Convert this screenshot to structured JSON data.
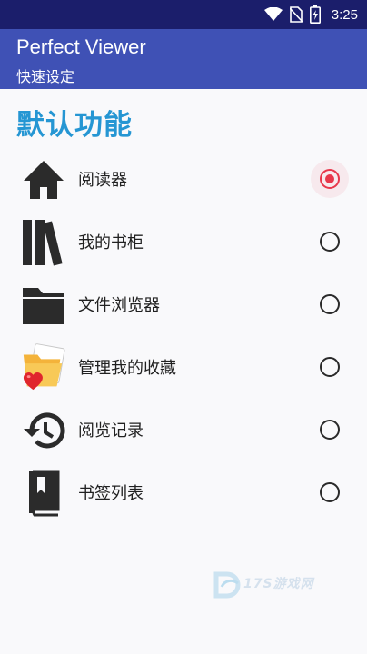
{
  "status_bar": {
    "time": "3:25",
    "icons": [
      "wifi-icon",
      "no-sim-icon",
      "battery-icon"
    ]
  },
  "app_bar": {
    "title": "Perfect Viewer",
    "subtitle": "快速设定"
  },
  "section": {
    "header": "默认功能"
  },
  "options": [
    {
      "label": "阅读器",
      "icon": "home-icon",
      "selected": true
    },
    {
      "label": "我的书柜",
      "icon": "bookshelf-icon",
      "selected": false
    },
    {
      "label": "文件浏览器",
      "icon": "folder-icon",
      "selected": false
    },
    {
      "label": "管理我的收藏",
      "icon": "favorite-folder-icon",
      "selected": false
    },
    {
      "label": "阅览记录",
      "icon": "history-icon",
      "selected": false
    },
    {
      "label": "书签列表",
      "icon": "bookmark-book-icon",
      "selected": false
    }
  ],
  "watermark": {
    "text": "17S游戏网"
  },
  "colors": {
    "status_bar": "#1b1e6b",
    "app_bar": "#3f51b5",
    "section_header": "#2596d3",
    "radio_selected": "#e8374b",
    "background": "#f9f9fb"
  }
}
